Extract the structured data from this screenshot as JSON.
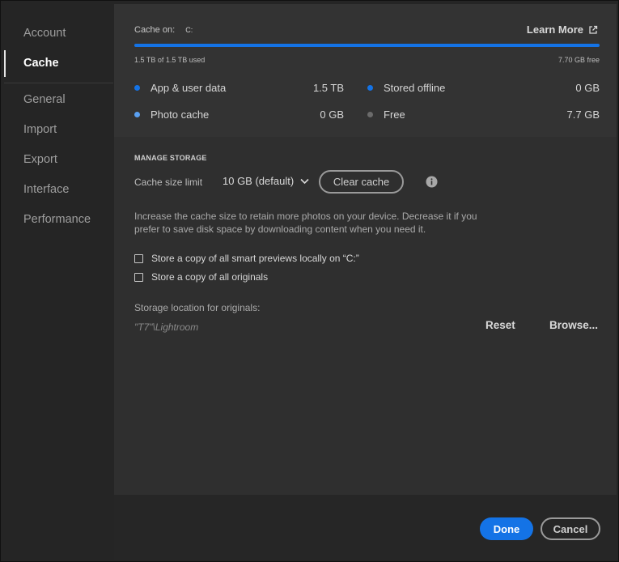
{
  "sidebar": {
    "items": [
      {
        "label": "Account",
        "active": false
      },
      {
        "label": "Cache",
        "active": true
      },
      {
        "label": "General",
        "active": false
      },
      {
        "label": "Import",
        "active": false
      },
      {
        "label": "Export",
        "active": false
      },
      {
        "label": "Interface",
        "active": false
      },
      {
        "label": "Performance",
        "active": false
      }
    ]
  },
  "cache_info": {
    "cache_on_label": "Cache on:",
    "drive": "C:",
    "learn_more": "Learn More",
    "used": "1.5 TB of 1.5 TB used",
    "free": "7.70 GB free",
    "usage_fraction": 1.0
  },
  "legend": [
    {
      "label": "App & user data",
      "value": "1.5 TB",
      "color": "#1473e6"
    },
    {
      "label": "Photo cache",
      "value": "0 GB",
      "color": "#5aa0f2"
    },
    {
      "label": "Stored offline",
      "value": "0 GB",
      "color": "#1473e6"
    },
    {
      "label": "Free",
      "value": "7.7 GB",
      "color": "#6b6b6b"
    }
  ],
  "manage": {
    "title": "MANAGE STORAGE",
    "cache_size_label": "Cache size limit",
    "cache_size_value": "10 GB (default)",
    "clear_cache": "Clear cache",
    "description": "Increase the cache size to retain more photos on your device. Decrease it if you prefer to save disk space by downloading content when you need it.",
    "checkbox_smart_previews": "Store a copy of all smart previews locally on “C:”",
    "checkbox_originals": "Store a copy of all originals",
    "storage_location_label": "Storage location for originals:",
    "storage_path": "\"T7\"\\Lightroom",
    "reset": "Reset",
    "browse": "Browse..."
  },
  "footer": {
    "done": "Done",
    "cancel": "Cancel"
  },
  "colors": {
    "accent": "#1473e6"
  }
}
